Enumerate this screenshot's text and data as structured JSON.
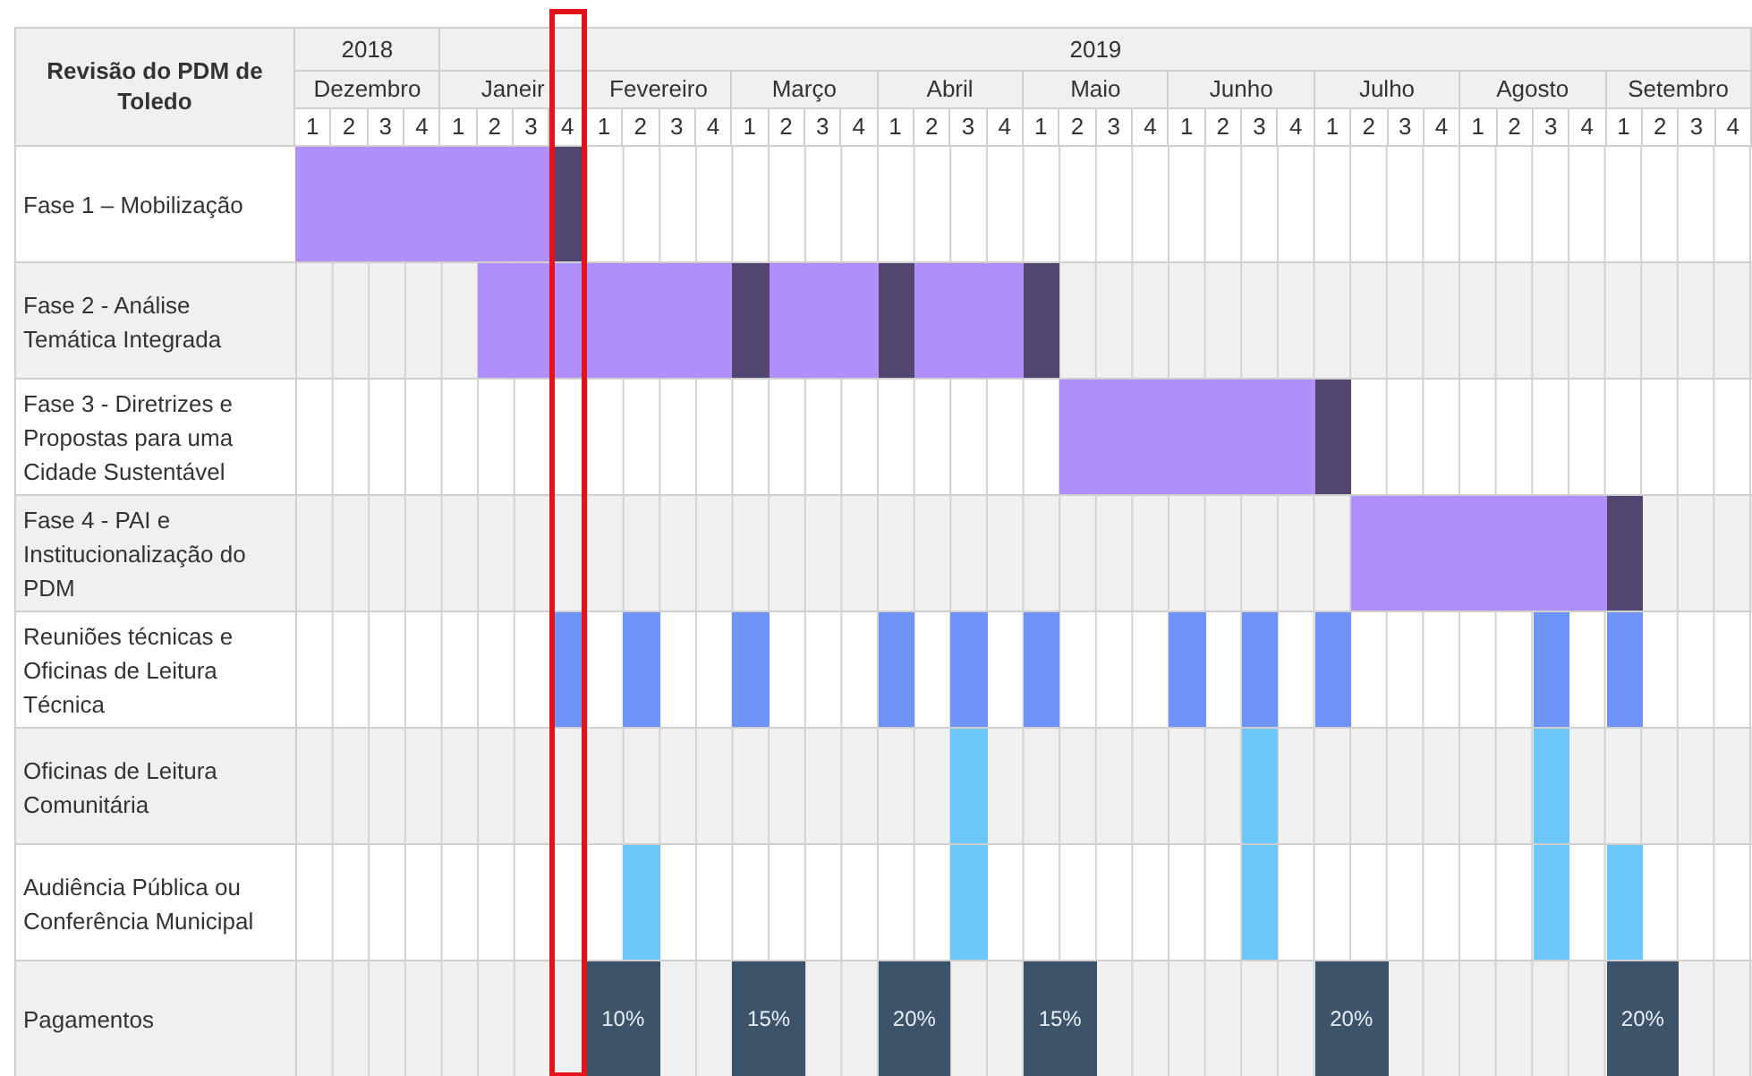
{
  "title": "Revisão do PDM de Toledo",
  "years": [
    {
      "label": "2018",
      "months": [
        {
          "name": "Dezembro",
          "weeks": [
            {
              "label": "1",
              "highlighted": false
            },
            {
              "label": "2",
              "highlighted": false
            },
            {
              "label": "3",
              "highlighted": false
            },
            {
              "label": "4",
              "highlighted": false
            }
          ]
        }
      ]
    },
    {
      "label": "2019",
      "months": [
        {
          "name": "Janeir",
          "weeks": [
            {
              "label": "1",
              "highlighted": false
            },
            {
              "label": "2",
              "highlighted": false
            },
            {
              "label": "3",
              "highlighted": false
            },
            {
              "label": "4",
              "highlighted": true
            }
          ]
        },
        {
          "name": "Fevereiro",
          "weeks": [
            {
              "label": "1",
              "highlighted": false
            },
            {
              "label": "2",
              "highlighted": false
            },
            {
              "label": "3",
              "highlighted": false
            },
            {
              "label": "4",
              "highlighted": false
            }
          ]
        },
        {
          "name": "Março",
          "weeks": [
            {
              "label": "1",
              "highlighted": false
            },
            {
              "label": "2",
              "highlighted": false
            },
            {
              "label": "3",
              "highlighted": false
            },
            {
              "label": "4",
              "highlighted": false
            }
          ]
        },
        {
          "name": "Abril",
          "weeks": [
            {
              "label": "1",
              "highlighted": false
            },
            {
              "label": "2",
              "highlighted": false
            },
            {
              "label": "3",
              "highlighted": false
            },
            {
              "label": "4",
              "highlighted": false
            }
          ]
        },
        {
          "name": "Maio",
          "weeks": [
            {
              "label": "1",
              "highlighted": false
            },
            {
              "label": "2",
              "highlighted": false
            },
            {
              "label": "3",
              "highlighted": false
            },
            {
              "label": "4",
              "highlighted": false
            }
          ]
        },
        {
          "name": "Junho",
          "weeks": [
            {
              "label": "1",
              "highlighted": false
            },
            {
              "label": "2",
              "highlighted": false
            },
            {
              "label": "3",
              "highlighted": false
            },
            {
              "label": "4",
              "highlighted": false
            }
          ]
        },
        {
          "name": "Julho",
          "weeks": [
            {
              "label": "1",
              "highlighted": false
            },
            {
              "label": "2",
              "highlighted": false
            },
            {
              "label": "3",
              "highlighted": false
            },
            {
              "label": "4",
              "highlighted": false
            }
          ]
        },
        {
          "name": "Agosto",
          "weeks": [
            {
              "label": "1",
              "highlighted": false
            },
            {
              "label": "2",
              "highlighted": false
            },
            {
              "label": "3",
              "highlighted": false
            },
            {
              "label": "4",
              "highlighted": false
            }
          ]
        },
        {
          "name": "Setembro",
          "weeks": [
            {
              "label": "1",
              "highlighted": false
            },
            {
              "label": "2",
              "highlighted": false
            },
            {
              "label": "3",
              "highlighted": false
            },
            {
              "label": "4",
              "highlighted": false
            }
          ]
        }
      ]
    }
  ],
  "rows": [
    {
      "label": "Fase 1 – Mobilização",
      "cells": [
        {
          "kind": "phase"
        },
        {
          "kind": "phase"
        },
        {
          "kind": "phase"
        },
        {
          "kind": "phase"
        },
        {
          "kind": "phase"
        },
        {
          "kind": "phase"
        },
        {
          "kind": "phase"
        },
        {
          "kind": "milestone"
        },
        {
          "kind": "none"
        },
        {
          "kind": "none"
        },
        {
          "kind": "none"
        },
        {
          "kind": "none"
        },
        {
          "kind": "none"
        },
        {
          "kind": "none"
        },
        {
          "kind": "none"
        },
        {
          "kind": "none"
        },
        {
          "kind": "none"
        },
        {
          "kind": "none"
        },
        {
          "kind": "none"
        },
        {
          "kind": "none"
        },
        {
          "kind": "none"
        },
        {
          "kind": "none"
        },
        {
          "kind": "none"
        },
        {
          "kind": "none"
        },
        {
          "kind": "none"
        },
        {
          "kind": "none"
        },
        {
          "kind": "none"
        },
        {
          "kind": "none"
        },
        {
          "kind": "none"
        },
        {
          "kind": "none"
        },
        {
          "kind": "none"
        },
        {
          "kind": "none"
        },
        {
          "kind": "none"
        },
        {
          "kind": "none"
        },
        {
          "kind": "none"
        },
        {
          "kind": "none"
        },
        {
          "kind": "none"
        },
        {
          "kind": "none"
        },
        {
          "kind": "none"
        },
        {
          "kind": "none"
        }
      ]
    },
    {
      "label": "Fase 2 - Análise Temática Integrada",
      "cells": [
        {
          "kind": "none"
        },
        {
          "kind": "none"
        },
        {
          "kind": "none"
        },
        {
          "kind": "none"
        },
        {
          "kind": "none"
        },
        {
          "kind": "phase"
        },
        {
          "kind": "phase"
        },
        {
          "kind": "phase"
        },
        {
          "kind": "phase"
        },
        {
          "kind": "phase"
        },
        {
          "kind": "phase"
        },
        {
          "kind": "phase"
        },
        {
          "kind": "milestone"
        },
        {
          "kind": "phase"
        },
        {
          "kind": "phase"
        },
        {
          "kind": "phase"
        },
        {
          "kind": "milestone"
        },
        {
          "kind": "phase"
        },
        {
          "kind": "phase"
        },
        {
          "kind": "phase"
        },
        {
          "kind": "milestone"
        },
        {
          "kind": "none"
        },
        {
          "kind": "none"
        },
        {
          "kind": "none"
        },
        {
          "kind": "none"
        },
        {
          "kind": "none"
        },
        {
          "kind": "none"
        },
        {
          "kind": "none"
        },
        {
          "kind": "none"
        },
        {
          "kind": "none"
        },
        {
          "kind": "none"
        },
        {
          "kind": "none"
        },
        {
          "kind": "none"
        },
        {
          "kind": "none"
        },
        {
          "kind": "none"
        },
        {
          "kind": "none"
        },
        {
          "kind": "none"
        },
        {
          "kind": "none"
        },
        {
          "kind": "none"
        },
        {
          "kind": "none"
        }
      ]
    },
    {
      "label": "Fase 3 - Diretrizes e Propostas para uma Cidade Sustentável",
      "cells": [
        {
          "kind": "none"
        },
        {
          "kind": "none"
        },
        {
          "kind": "none"
        },
        {
          "kind": "none"
        },
        {
          "kind": "none"
        },
        {
          "kind": "none"
        },
        {
          "kind": "none"
        },
        {
          "kind": "none"
        },
        {
          "kind": "none"
        },
        {
          "kind": "none"
        },
        {
          "kind": "none"
        },
        {
          "kind": "none"
        },
        {
          "kind": "none"
        },
        {
          "kind": "none"
        },
        {
          "kind": "none"
        },
        {
          "kind": "none"
        },
        {
          "kind": "none"
        },
        {
          "kind": "none"
        },
        {
          "kind": "none"
        },
        {
          "kind": "none"
        },
        {
          "kind": "none"
        },
        {
          "kind": "phase"
        },
        {
          "kind": "phase"
        },
        {
          "kind": "phase"
        },
        {
          "kind": "phase"
        },
        {
          "kind": "phase"
        },
        {
          "kind": "phase"
        },
        {
          "kind": "phase"
        },
        {
          "kind": "milestone"
        },
        {
          "kind": "none"
        },
        {
          "kind": "none"
        },
        {
          "kind": "none"
        },
        {
          "kind": "none"
        },
        {
          "kind": "none"
        },
        {
          "kind": "none"
        },
        {
          "kind": "none"
        },
        {
          "kind": "none"
        },
        {
          "kind": "none"
        },
        {
          "kind": "none"
        },
        {
          "kind": "none"
        }
      ]
    },
    {
      "label": "Fase 4 - PAI e Institucionalização do PDM",
      "cells": [
        {
          "kind": "none"
        },
        {
          "kind": "none"
        },
        {
          "kind": "none"
        },
        {
          "kind": "none"
        },
        {
          "kind": "none"
        },
        {
          "kind": "none"
        },
        {
          "kind": "none"
        },
        {
          "kind": "none"
        },
        {
          "kind": "none"
        },
        {
          "kind": "none"
        },
        {
          "kind": "none"
        },
        {
          "kind": "none"
        },
        {
          "kind": "none"
        },
        {
          "kind": "none"
        },
        {
          "kind": "none"
        },
        {
          "kind": "none"
        },
        {
          "kind": "none"
        },
        {
          "kind": "none"
        },
        {
          "kind": "none"
        },
        {
          "kind": "none"
        },
        {
          "kind": "none"
        },
        {
          "kind": "none"
        },
        {
          "kind": "none"
        },
        {
          "kind": "none"
        },
        {
          "kind": "none"
        },
        {
          "kind": "none"
        },
        {
          "kind": "none"
        },
        {
          "kind": "none"
        },
        {
          "kind": "none"
        },
        {
          "kind": "phase"
        },
        {
          "kind": "phase"
        },
        {
          "kind": "phase"
        },
        {
          "kind": "phase"
        },
        {
          "kind": "phase"
        },
        {
          "kind": "phase"
        },
        {
          "kind": "phase"
        },
        {
          "kind": "milestone"
        },
        {
          "kind": "none"
        },
        {
          "kind": "none"
        },
        {
          "kind": "none"
        }
      ]
    },
    {
      "label": "Reuniões técnicas e Oficinas de Leitura Técnica",
      "cells": [
        {
          "kind": "none"
        },
        {
          "kind": "none"
        },
        {
          "kind": "none"
        },
        {
          "kind": "none"
        },
        {
          "kind": "none"
        },
        {
          "kind": "none"
        },
        {
          "kind": "none"
        },
        {
          "kind": "meeting"
        },
        {
          "kind": "none"
        },
        {
          "kind": "meeting"
        },
        {
          "kind": "none"
        },
        {
          "kind": "none"
        },
        {
          "kind": "meeting"
        },
        {
          "kind": "none"
        },
        {
          "kind": "none"
        },
        {
          "kind": "none"
        },
        {
          "kind": "meeting"
        },
        {
          "kind": "none"
        },
        {
          "kind": "meeting"
        },
        {
          "kind": "none"
        },
        {
          "kind": "meeting"
        },
        {
          "kind": "none"
        },
        {
          "kind": "none"
        },
        {
          "kind": "none"
        },
        {
          "kind": "meeting"
        },
        {
          "kind": "none"
        },
        {
          "kind": "meeting"
        },
        {
          "kind": "none"
        },
        {
          "kind": "meeting"
        },
        {
          "kind": "none"
        },
        {
          "kind": "none"
        },
        {
          "kind": "none"
        },
        {
          "kind": "none"
        },
        {
          "kind": "none"
        },
        {
          "kind": "meeting"
        },
        {
          "kind": "none"
        },
        {
          "kind": "meeting"
        },
        {
          "kind": "none"
        },
        {
          "kind": "none"
        },
        {
          "kind": "none"
        }
      ]
    },
    {
      "label": "Oficinas de Leitura Comunitária",
      "cells": [
        {
          "kind": "none"
        },
        {
          "kind": "none"
        },
        {
          "kind": "none"
        },
        {
          "kind": "none"
        },
        {
          "kind": "none"
        },
        {
          "kind": "none"
        },
        {
          "kind": "none"
        },
        {
          "kind": "none"
        },
        {
          "kind": "none"
        },
        {
          "kind": "none"
        },
        {
          "kind": "none"
        },
        {
          "kind": "none"
        },
        {
          "kind": "none"
        },
        {
          "kind": "none"
        },
        {
          "kind": "none"
        },
        {
          "kind": "none"
        },
        {
          "kind": "none"
        },
        {
          "kind": "none"
        },
        {
          "kind": "public"
        },
        {
          "kind": "none"
        },
        {
          "kind": "none"
        },
        {
          "kind": "none"
        },
        {
          "kind": "none"
        },
        {
          "kind": "none"
        },
        {
          "kind": "none"
        },
        {
          "kind": "none"
        },
        {
          "kind": "public"
        },
        {
          "kind": "none"
        },
        {
          "kind": "none"
        },
        {
          "kind": "none"
        },
        {
          "kind": "none"
        },
        {
          "kind": "none"
        },
        {
          "kind": "none"
        },
        {
          "kind": "none"
        },
        {
          "kind": "public"
        },
        {
          "kind": "none"
        },
        {
          "kind": "none"
        },
        {
          "kind": "none"
        },
        {
          "kind": "none"
        },
        {
          "kind": "none"
        }
      ]
    },
    {
      "label": "Audiência Pública ou Conferência Municipal",
      "cells": [
        {
          "kind": "none"
        },
        {
          "kind": "none"
        },
        {
          "kind": "none"
        },
        {
          "kind": "none"
        },
        {
          "kind": "none"
        },
        {
          "kind": "none"
        },
        {
          "kind": "none"
        },
        {
          "kind": "none"
        },
        {
          "kind": "none"
        },
        {
          "kind": "public"
        },
        {
          "kind": "none"
        },
        {
          "kind": "none"
        },
        {
          "kind": "none"
        },
        {
          "kind": "none"
        },
        {
          "kind": "none"
        },
        {
          "kind": "none"
        },
        {
          "kind": "none"
        },
        {
          "kind": "none"
        },
        {
          "kind": "public"
        },
        {
          "kind": "none"
        },
        {
          "kind": "none"
        },
        {
          "kind": "none"
        },
        {
          "kind": "none"
        },
        {
          "kind": "none"
        },
        {
          "kind": "none"
        },
        {
          "kind": "none"
        },
        {
          "kind": "public"
        },
        {
          "kind": "none"
        },
        {
          "kind": "none"
        },
        {
          "kind": "none"
        },
        {
          "kind": "none"
        },
        {
          "kind": "none"
        },
        {
          "kind": "none"
        },
        {
          "kind": "none"
        },
        {
          "kind": "public"
        },
        {
          "kind": "none"
        },
        {
          "kind": "public"
        },
        {
          "kind": "none"
        },
        {
          "kind": "none"
        },
        {
          "kind": "none"
        }
      ]
    },
    {
      "label": "Pagamentos",
      "labels": [
        "10%",
        "15%",
        "20%",
        "15%",
        "20%",
        "20%"
      ],
      "cells": [
        {
          "kind": "none"
        },
        {
          "kind": "none"
        },
        {
          "kind": "none"
        },
        {
          "kind": "none"
        },
        {
          "kind": "none"
        },
        {
          "kind": "none"
        },
        {
          "kind": "none"
        },
        {
          "kind": "none"
        },
        {
          "kind": "payment"
        },
        {
          "kind": "payment"
        },
        {
          "kind": "none"
        },
        {
          "kind": "none"
        },
        {
          "kind": "payment"
        },
        {
          "kind": "payment"
        },
        {
          "kind": "none"
        },
        {
          "kind": "none"
        },
        {
          "kind": "payment"
        },
        {
          "kind": "payment"
        },
        {
          "kind": "none"
        },
        {
          "kind": "none"
        },
        {
          "kind": "payment"
        },
        {
          "kind": "payment"
        },
        {
          "kind": "none"
        },
        {
          "kind": "none"
        },
        {
          "kind": "none"
        },
        {
          "kind": "none"
        },
        {
          "kind": "none"
        },
        {
          "kind": "none"
        },
        {
          "kind": "payment"
        },
        {
          "kind": "payment"
        },
        {
          "kind": "none"
        },
        {
          "kind": "none"
        },
        {
          "kind": "none"
        },
        {
          "kind": "none"
        },
        {
          "kind": "none"
        },
        {
          "kind": "none"
        },
        {
          "kind": "payment"
        },
        {
          "kind": "payment"
        },
        {
          "kind": "none"
        },
        {
          "kind": "none"
        }
      ]
    }
  ]
}
